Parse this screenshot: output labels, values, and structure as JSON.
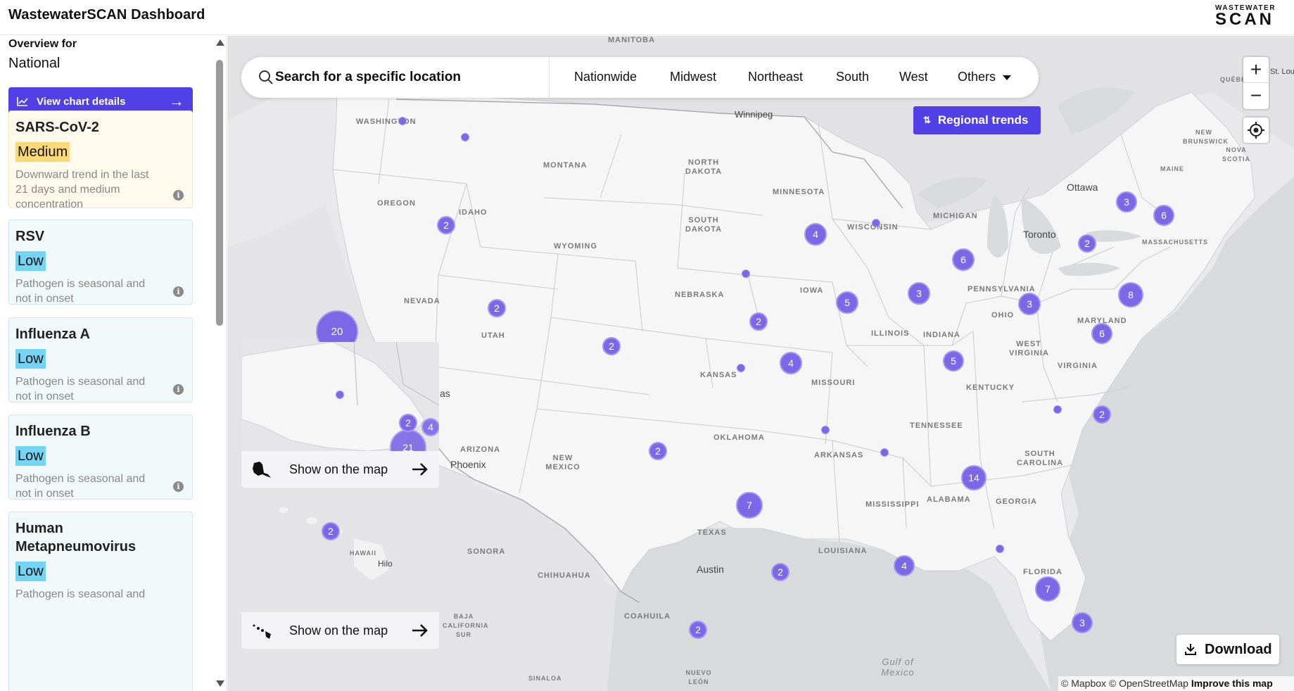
{
  "header": {
    "title": "WastewaterSCAN Dashboard",
    "logo_line1": "WASTEWATER",
    "logo_line2": "SCAN"
  },
  "sidebar": {
    "overview_label": "Overview for",
    "overview_value": "National",
    "chart_button": "View chart details",
    "cards": [
      {
        "name": "SARS-CoV-2",
        "level": "Medium",
        "description": "Downward trend in the last 21 days and medium concentration"
      },
      {
        "name": "RSV",
        "level": "Low",
        "description": "Pathogen is seasonal and not in onset"
      },
      {
        "name": "Influenza A",
        "level": "Low",
        "description": "Pathogen is seasonal and not in onset"
      },
      {
        "name": "Influenza B",
        "level": "Low",
        "description": "Pathogen is seasonal and not in onset"
      },
      {
        "name": "Human Metapneumovirus",
        "level": "Low",
        "description": "Pathogen is seasonal and"
      }
    ]
  },
  "search": {
    "placeholder": "Search for a specific location"
  },
  "regions": [
    "Nationwide",
    "Midwest",
    "Northeast",
    "South",
    "West",
    "Others"
  ],
  "regional_trends_button": "Regional trends",
  "zoom": {
    "in": "+",
    "out": "−"
  },
  "insets": {
    "alaska_label": "Show on the map",
    "hawaii_label": "Show on the map",
    "alaska_cluster": "21"
  },
  "download_label": "Download",
  "attribution": {
    "mapbox": "© Mapbox",
    "osm": "© OpenStreetMap",
    "improve": "Improve this map"
  },
  "map_labels": {
    "states": [
      "WASHINGTON",
      "MONTANA",
      "NORTH DAKOTA",
      "MINNESOTA",
      "OREGON",
      "IDAHO",
      "SOUTH DAKOTA",
      "WISCONSIN",
      "MICHIGAN",
      "WYOMING",
      "NEBRASKA",
      "IOWA",
      "NEVADA",
      "UTAH",
      "PENNSYLVANIA",
      "OHIO",
      "ILLINOIS",
      "INDIANA",
      "KANSAS",
      "MISSOURI",
      "WEST VIRGINIA",
      "VIRGINIA",
      "MARYLAND",
      "KENTUCKY",
      "ARIZONA",
      "NEW MEXICO",
      "OKLAHOMA",
      "TENNESSEE",
      "ARKANSAS",
      "SOUTH CAROLINA",
      "MISSISSIPPI",
      "ALABAMA",
      "GEORGIA",
      "TEXAS",
      "LOUISIANA",
      "FLORIDA",
      "SONORA",
      "CHIHUAHUA",
      "COAHUILA",
      "BAJA CALIFORNIA SUR",
      "NUEVO LEÓN",
      "SINALOA",
      "HAWAII",
      "MASSACHUSETTS",
      "MAINE",
      "NOVA SCOTIA",
      "NEW BRUNSWICK",
      "QUÉBEC",
      "MANITOBA"
    ],
    "cities": [
      "Winnipeg",
      "Ottawa",
      "Toronto",
      "Phoenix",
      "Austin",
      "Hilo",
      "St. Lou",
      "as"
    ],
    "water": "Gulf of Mexico"
  },
  "clusters": [
    "20",
    "2",
    "2",
    "2",
    "4",
    "2",
    "4",
    "5",
    "3",
    "6",
    "3",
    "3",
    "2",
    "6",
    "8",
    "6",
    "5",
    "2",
    "2",
    "7",
    "14",
    "4",
    "2",
    "2",
    "7",
    "3",
    "2",
    "2",
    "4"
  ]
}
